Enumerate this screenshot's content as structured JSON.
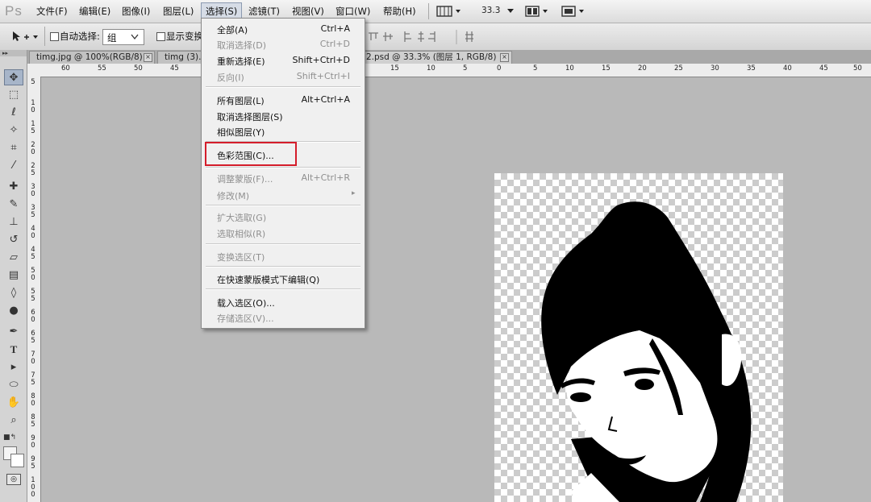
{
  "app": {
    "logo": "Ps",
    "zoom": "33.3"
  },
  "menubar": {
    "items": [
      {
        "label": "文件(F)"
      },
      {
        "label": "编辑(E)"
      },
      {
        "label": "图像(I)"
      },
      {
        "label": "图层(L)"
      },
      {
        "label": "选择(S)",
        "active": true
      },
      {
        "label": "滤镜(T)"
      },
      {
        "label": "视图(V)"
      },
      {
        "label": "窗口(W)"
      },
      {
        "label": "帮助(H)"
      }
    ]
  },
  "options": {
    "auto_select_label": "自动选择:",
    "auto_select_value": "组",
    "show_transform_label": "显示变换"
  },
  "tabs": [
    {
      "label": "timg.jpg @ 100%(RGB/8)"
    },
    {
      "label": "timg (3)."
    },
    {
      "label": "2.psd @ 33.3% (图层 1, RGB/8)"
    }
  ],
  "ruler": {
    "h_labels": [
      "60",
      "55",
      "50",
      "45",
      "15",
      "10",
      "5",
      "0",
      "5",
      "10",
      "15",
      "20",
      "25",
      "30",
      "35",
      "40",
      "45",
      "50"
    ],
    "v_labels": [
      "5",
      "1\n0",
      "1\n5",
      "2\n0",
      "2\n5",
      "3\n0",
      "3\n5",
      "4\n0",
      "4\n5",
      "5\n0",
      "5\n5",
      "6\n0",
      "6\n5",
      "7\n0",
      "7\n5",
      "8\n0",
      "8\n5",
      "9\n0",
      "9\n5",
      "1\n0\n0"
    ]
  },
  "select_menu": {
    "items": [
      {
        "label": "全部(A)",
        "shortcut": "Ctrl+A",
        "disabled": false
      },
      {
        "label": "取消选择(D)",
        "shortcut": "Ctrl+D",
        "disabled": true
      },
      {
        "label": "重新选择(E)",
        "shortcut": "Shift+Ctrl+D",
        "disabled": false
      },
      {
        "label": "反向(I)",
        "shortcut": "Shift+Ctrl+I",
        "disabled": true
      },
      {
        "label": "所有图层(L)",
        "shortcut": "Alt+Ctrl+A",
        "disabled": false
      },
      {
        "label": "取消选择图层(S)",
        "shortcut": "",
        "disabled": false
      },
      {
        "label": "相似图层(Y)",
        "shortcut": "",
        "disabled": false
      },
      {
        "label": "色彩范围(C)...",
        "shortcut": "",
        "disabled": false,
        "highlighted": true
      },
      {
        "label": "调整蒙版(F)...",
        "shortcut": "Alt+Ctrl+R",
        "disabled": true
      },
      {
        "label": "修改(M)",
        "shortcut": "",
        "disabled": true,
        "submenu": true
      },
      {
        "label": "扩大选取(G)",
        "shortcut": "",
        "disabled": true
      },
      {
        "label": "选取相似(R)",
        "shortcut": "",
        "disabled": true
      },
      {
        "label": "变换选区(T)",
        "shortcut": "",
        "disabled": true
      },
      {
        "label": "在快速蒙版模式下编辑(Q)",
        "shortcut": "",
        "disabled": false
      },
      {
        "label": "载入选区(O)...",
        "shortcut": "",
        "disabled": false
      },
      {
        "label": "存储选区(V)...",
        "shortcut": "",
        "disabled": true
      }
    ]
  },
  "colors": {
    "highlight": "#d41d2b",
    "menu_bg": "#f0f0f0",
    "workspace": "#b9b9b9"
  }
}
